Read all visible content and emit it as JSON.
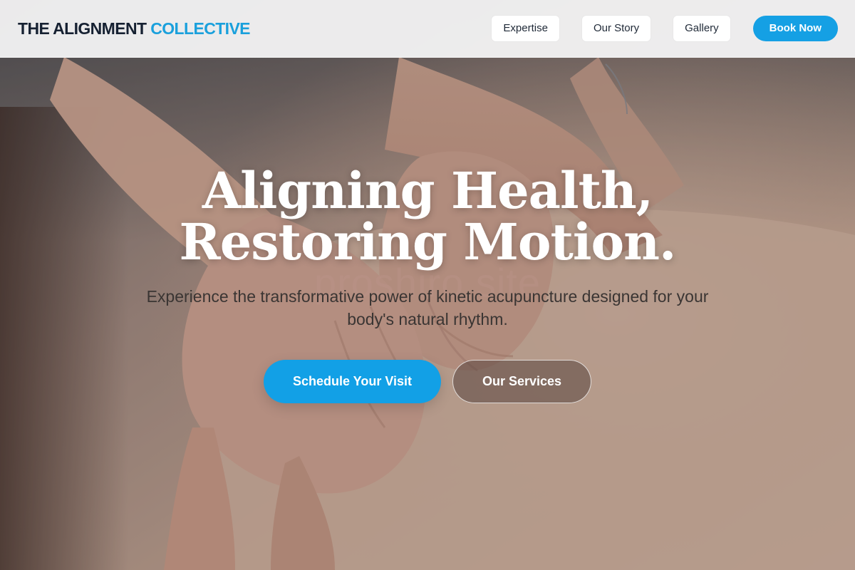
{
  "header": {
    "brand_primary": "THE ALIGNMENT",
    "brand_accent": "COLLECTIVE",
    "nav": [
      {
        "label": "Expertise"
      },
      {
        "label": "Our Story"
      },
      {
        "label": "Gallery"
      }
    ],
    "book_label": "Book Now"
  },
  "hero": {
    "title_line1": "Aligning Health,",
    "title_line2": "Restoring Motion.",
    "subtitle": "Experience the transformative power of kinetic acupuncture designed for your body's natural rhythm.",
    "watermark": "proshiro site",
    "primary_cta": "Schedule Your Visit",
    "secondary_cta": "Our Services",
    "image_subject": "therapist hands massaging a client's back"
  },
  "colors": {
    "accent": "#15a0e4",
    "brand_dark": "#162132",
    "brand_accent": "#1aa0dc",
    "header_bg": "#f0f0f1",
    "title_text": "#ffffff"
  }
}
